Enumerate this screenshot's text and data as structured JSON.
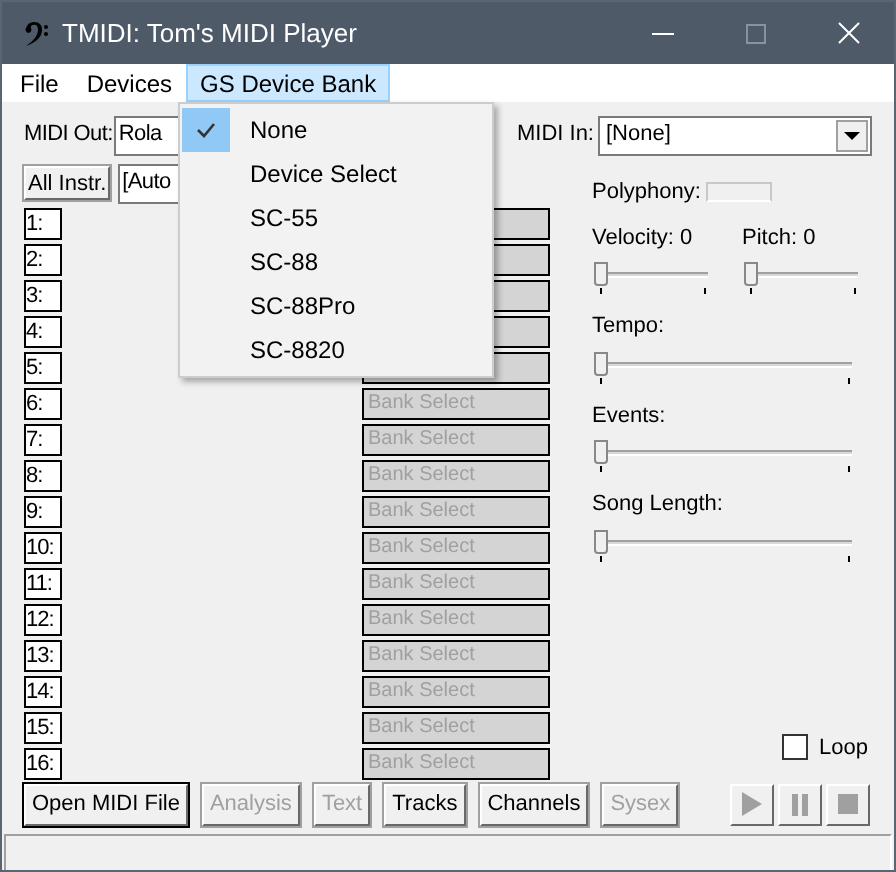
{
  "window": {
    "title": "TMIDI: Tom's MIDI Player"
  },
  "menu_bar": [
    {
      "label": "File",
      "selected": false
    },
    {
      "label": "Devices",
      "selected": false
    },
    {
      "label": "GS Device Bank",
      "selected": true
    }
  ],
  "gs_device_bank_menu": [
    {
      "label": "None",
      "checked": true
    },
    {
      "label": "Device Select",
      "checked": false
    },
    {
      "label": "SC-55",
      "checked": false
    },
    {
      "label": "SC-88",
      "checked": false
    },
    {
      "label": "SC-88Pro",
      "checked": false
    },
    {
      "label": "SC-8820",
      "checked": false
    }
  ],
  "midi_out": {
    "label": "MIDI Out:",
    "value": "Rola"
  },
  "midi_in": {
    "label": "MIDI In:",
    "value": "[None]"
  },
  "all_instruments_button": "All Instr.",
  "instrument_select": {
    "value": "[Auto"
  },
  "channels": [
    {
      "number": "1:"
    },
    {
      "number": "2:"
    },
    {
      "number": "3:"
    },
    {
      "number": "4:"
    },
    {
      "number": "5:"
    },
    {
      "number": "6:",
      "bank": "Bank Select"
    },
    {
      "number": "7:",
      "bank": "Bank Select"
    },
    {
      "number": "8:",
      "bank": "Bank Select"
    },
    {
      "number": "9:",
      "bank": "Bank Select"
    },
    {
      "number": "10:",
      "bank": "Bank Select"
    },
    {
      "number": "11:",
      "bank": "Bank Select"
    },
    {
      "number": "12:",
      "bank": "Bank Select"
    },
    {
      "number": "13:",
      "bank": "Bank Select"
    },
    {
      "number": "14:",
      "bank": "Bank Select"
    },
    {
      "number": "15:",
      "bank": "Bank Select"
    },
    {
      "number": "16:",
      "bank": "Bank Select"
    }
  ],
  "polyphony": {
    "label": "Polyphony:"
  },
  "short_sliders": [
    {
      "label": "Velocity: 0",
      "level": 0
    },
    {
      "label": "Pitch: 0",
      "level": 0
    }
  ],
  "sliders": [
    {
      "label": "Tempo:",
      "level": 0
    },
    {
      "label": "Events:",
      "level": 0
    },
    {
      "label": "Song Length:",
      "level": 0
    }
  ],
  "loop": {
    "label": "Loop",
    "checked": false
  },
  "buttons": [
    {
      "label": "Open MIDI File",
      "disabled": false
    },
    {
      "label": "Analysis",
      "disabled": true
    },
    {
      "label": "Text",
      "disabled": true
    },
    {
      "label": "Tracks",
      "disabled": false
    },
    {
      "label": "Channels",
      "disabled": false
    },
    {
      "label": "Sysex",
      "disabled": true
    }
  ],
  "transport": [
    {
      "kind": "play",
      "disabled": true
    },
    {
      "kind": "pause",
      "disabled": true
    },
    {
      "kind": "stop",
      "disabled": true
    }
  ]
}
